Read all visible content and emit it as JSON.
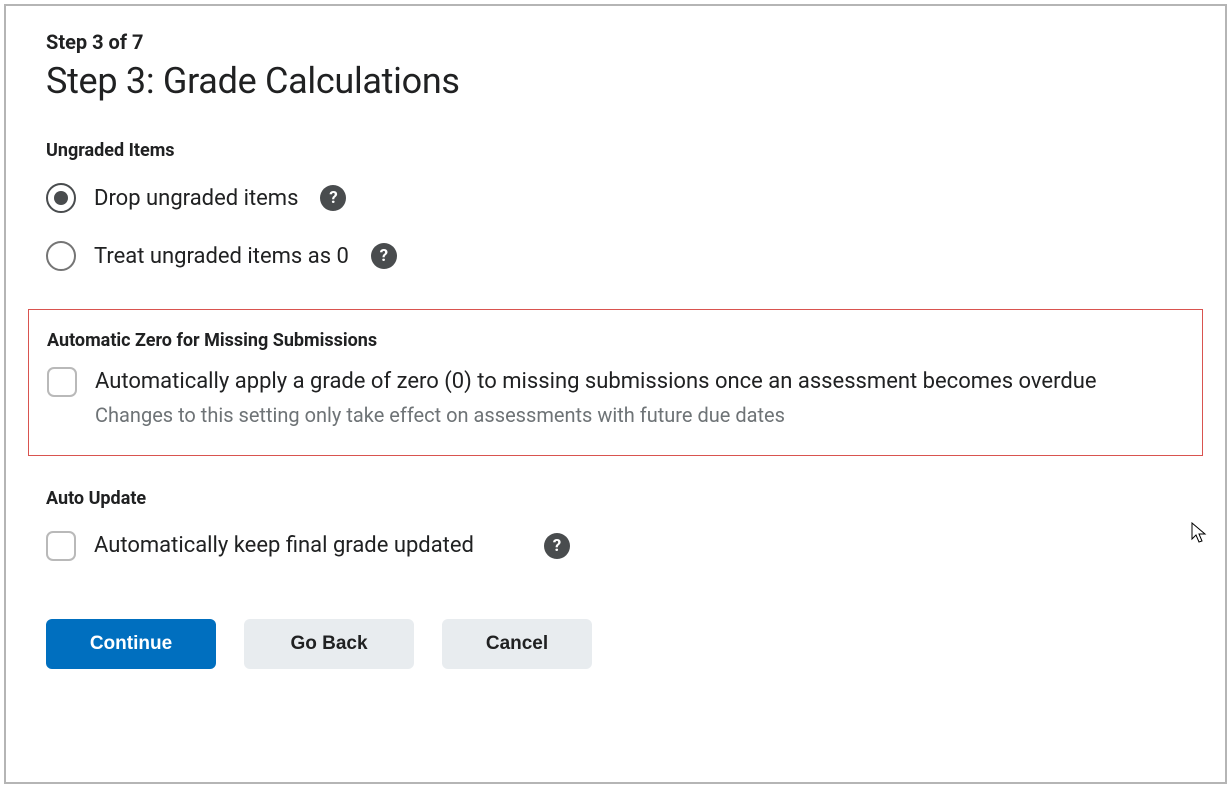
{
  "step": {
    "indicator": "Step 3 of 7",
    "title": "Step 3: Grade Calculations"
  },
  "ungraded": {
    "heading": "Ungraded Items",
    "options": [
      {
        "label": "Drop ungraded items",
        "selected": true
      },
      {
        "label": "Treat ungraded items as 0",
        "selected": false
      }
    ]
  },
  "autoZero": {
    "heading": "Automatic Zero for Missing Submissions",
    "label": "Automatically apply a grade of zero (0) to missing submissions once an assessment becomes overdue",
    "sublabel": "Changes to this setting only take effect on assessments with future due dates"
  },
  "autoUpdate": {
    "heading": "Auto Update",
    "label": "Automatically keep final grade updated"
  },
  "buttons": {
    "continue": "Continue",
    "goBack": "Go Back",
    "cancel": "Cancel"
  }
}
